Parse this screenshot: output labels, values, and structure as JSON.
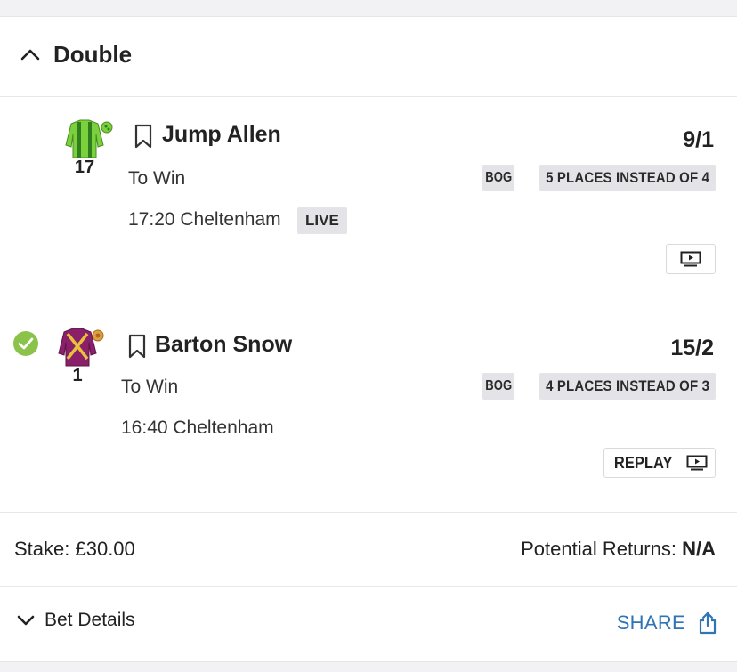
{
  "bet": {
    "type_label": "Double",
    "selections": [
      {
        "horse": "Jump Allen",
        "saddle_number": "17",
        "odds": "9/1",
        "market": "To Win",
        "race": "17:20 Cheltenham",
        "live_badge": "LIVE",
        "bog_badge": "BOG",
        "places_badge": "5 PLACES INSTEAD OF 4",
        "silk_colors": {
          "body": "#7bd13b",
          "stripe": "#2f7d1e",
          "cap": "#7bd13b"
        }
      },
      {
        "horse": "Barton Snow",
        "saddle_number": "1",
        "odds": "15/2",
        "market": "To Win",
        "race": "16:40 Cheltenham",
        "bog_badge": "BOG",
        "places_badge": "4 PLACES INSTEAD OF 3",
        "replay_label": "REPLAY",
        "status": "won",
        "silk_colors": {
          "body": "#8a1f6a",
          "cross": "#e8c23a",
          "cap": "#e0a040"
        }
      }
    ],
    "stake": "Stake: £30.00",
    "potential_returns_label": "Potential Returns:",
    "potential_returns_value": "N/A",
    "bet_details_label": "Bet Details",
    "share_label": "SHARE"
  },
  "colors": {
    "accent": "#2f74b5",
    "win_green": "#8bc34a",
    "badge_bg": "#e4e4e8"
  }
}
